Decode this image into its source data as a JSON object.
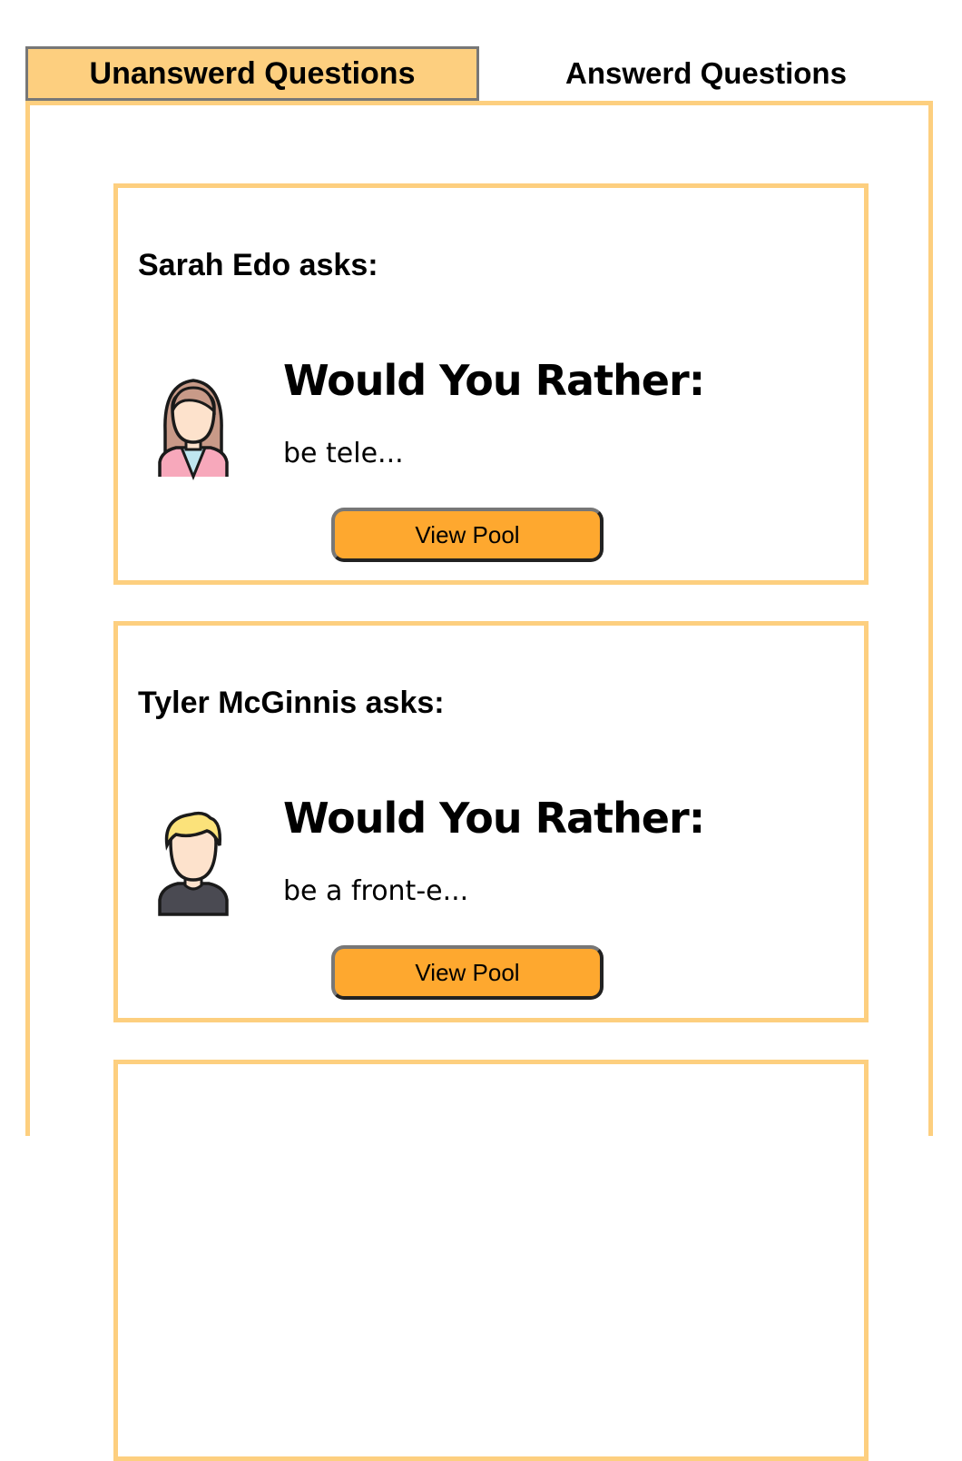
{
  "tabs": {
    "unanswered": "Unanswerd Questions",
    "answered": "Answerd Questions"
  },
  "questions": [
    {
      "asker": "Sarah Edo asks:",
      "title": "Would You Rather:",
      "option_preview": "be tele...",
      "button_label": "View Pool",
      "avatar_icon": "female-avatar-icon"
    },
    {
      "asker": "Tyler McGinnis asks:",
      "title": "Would You Rather:",
      "option_preview": "be a front-e...",
      "button_label": "View Pool",
      "avatar_icon": "male-avatar-icon"
    }
  ],
  "colors": {
    "accent_border": "#fdcf7f",
    "button": "#fea82f",
    "active_tab": "#fdcf7f"
  }
}
